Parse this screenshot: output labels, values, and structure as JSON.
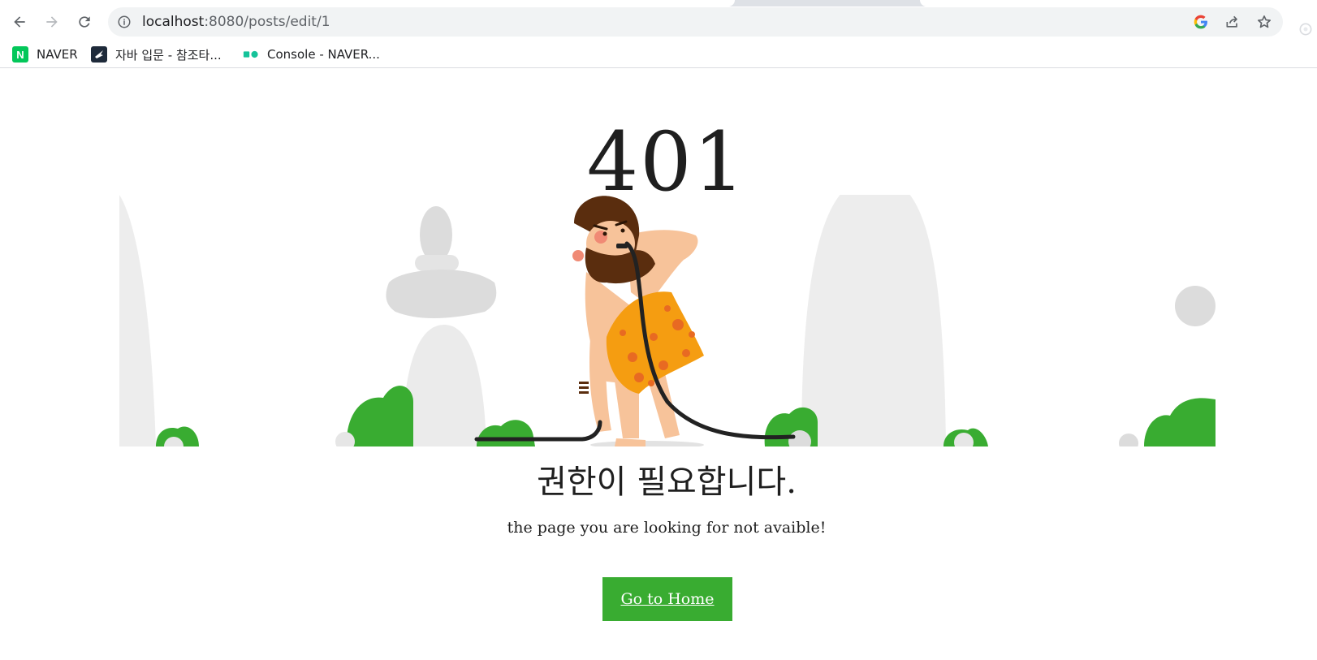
{
  "browser": {
    "url_host": "localhost",
    "url_path": ":8080/posts/edit/1",
    "bookmarks": [
      {
        "label": "NAVER",
        "icon": "naver-favicon"
      },
      {
        "label": "자바 입문 - 참조타...",
        "icon": "java-favicon"
      },
      {
        "label": "Console - NAVER...",
        "icon": "ncloud-favicon"
      }
    ],
    "favicon_letter": "N"
  },
  "page": {
    "error_code": "401",
    "headline": "권한이 필요합니다.",
    "message": "the page you are looking for not avaible!",
    "home_button": "Go to Home",
    "accent_color": "#39ac31"
  }
}
